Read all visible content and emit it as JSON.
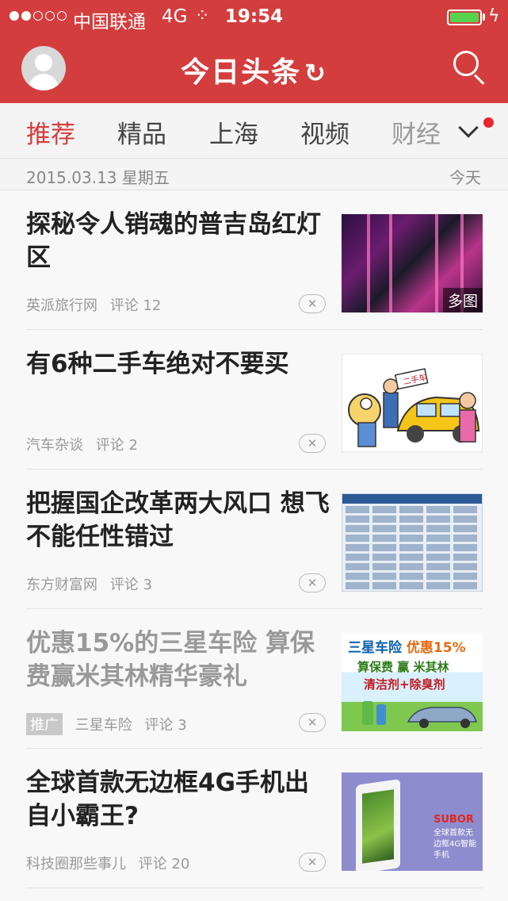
{
  "status_bar": {
    "carrier": "中国联通",
    "network": "4G",
    "time": "19:54",
    "spinner": "⁘",
    "battery_color": "#55d34f"
  },
  "header": {
    "title": "今日头条",
    "refresh_glyph": "↻",
    "avatar_icon": "user-avatar-icon",
    "search_icon": "search-icon",
    "accent_color": "#d43d3d"
  },
  "channels": [
    {
      "label": "推荐",
      "active": true
    },
    {
      "label": "精品",
      "active": false
    },
    {
      "label": "上海",
      "active": false
    },
    {
      "label": "视频",
      "active": false
    },
    {
      "label": "财经",
      "active": false
    }
  ],
  "date_bar": {
    "date": "2015.03.13 星期五",
    "today": "今天"
  },
  "feed": [
    {
      "title": "探秘令人销魂的普吉岛红灯区",
      "source": "英派旅行网",
      "comments": "评论 12",
      "badge": "多图",
      "dismiss": "✕"
    },
    {
      "title": "有6种二手车绝对不要买",
      "source": "汽车杂谈",
      "comments": "评论 2",
      "dismiss": "✕",
      "image_label": "二手车"
    },
    {
      "title": "把握国企改革两大风口 想飞不能任性错过",
      "source": "东方财富网",
      "comments": "评论 3",
      "dismiss": "✕"
    },
    {
      "title": "优惠15%的三星车险 算保费赢米其林精华豪礼",
      "tag": "推广",
      "source": "三星车险",
      "comments": "评论 3",
      "dismiss": "✕",
      "ad_line1": "三星车险",
      "ad_line1_b": "优惠15%",
      "ad_line2": "算保费 赢 米其林",
      "ad_line3": "清洁剂+除臭剂"
    },
    {
      "title": "全球首款无边框4G手机出自小霸王?",
      "source": "科技圈那些事儿",
      "comments": "评论 20",
      "dismiss": "✕",
      "ad_logo": "SUBOR",
      "ad_caption": "全球首款无边框4G智能手机"
    }
  ]
}
